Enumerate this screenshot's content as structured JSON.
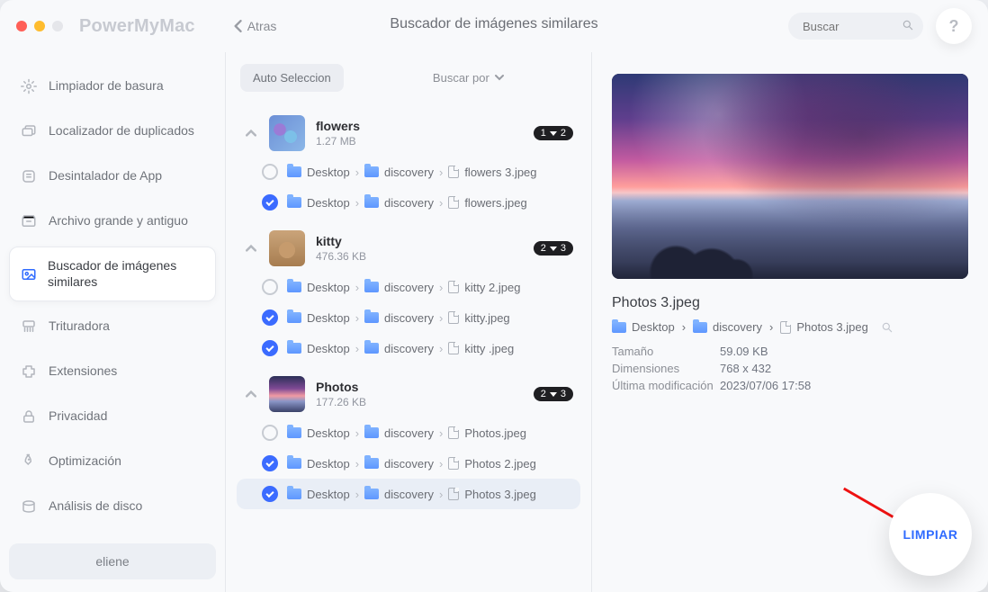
{
  "app": {
    "name": "PowerMyMac",
    "back": "Atras",
    "title": "Buscador de imágenes similares"
  },
  "search": {
    "placeholder": "Buscar"
  },
  "help": {
    "symbol": "?"
  },
  "sidebar": {
    "items": [
      {
        "label": "Limpiador de basura"
      },
      {
        "label": "Localizador de duplicados"
      },
      {
        "label": "Desintalador de App"
      },
      {
        "label": "Archivo grande y antiguo"
      },
      {
        "label": "Buscador de imágenes similares"
      },
      {
        "label": "Trituradora"
      },
      {
        "label": "Extensiones"
      },
      {
        "label": "Privacidad"
      },
      {
        "label": "Optimización"
      },
      {
        "label": "Análisis de disco"
      }
    ],
    "user": "eliene"
  },
  "toolbar": {
    "auto": "Auto Seleccion",
    "sort": "Buscar por"
  },
  "path": {
    "p1": "Desktop",
    "p2": "discovery"
  },
  "groups": [
    {
      "name": "flowers",
      "size": "1.27 MB",
      "badge": "1 · 2",
      "rows": [
        {
          "checked": false,
          "file": "flowers 3.jpeg"
        },
        {
          "checked": true,
          "file": "flowers.jpeg"
        }
      ]
    },
    {
      "name": "kitty",
      "size": "476.36 KB",
      "badge": "2 · 3",
      "rows": [
        {
          "checked": false,
          "file": "kitty 2.jpeg"
        },
        {
          "checked": true,
          "file": "kitty.jpeg"
        },
        {
          "checked": true,
          "file": "kitty .jpeg"
        }
      ]
    },
    {
      "name": "Photos",
      "size": "177.26 KB",
      "badge": "2 · 3",
      "rows": [
        {
          "checked": false,
          "file": "Photos.jpeg"
        },
        {
          "checked": true,
          "file": "Photos 2.jpeg"
        },
        {
          "checked": true,
          "file": "Photos 3.jpeg",
          "selected": true
        }
      ]
    }
  ],
  "preview": {
    "file": "Photos 3.jpeg",
    "path_file": "Photos 3.jpeg",
    "meta": {
      "size_label": "Tamaño",
      "size": "59.09 KB",
      "dims_label": "Dimensiones",
      "dims": "768 x 432",
      "mod_label": "Última modificación",
      "mod": "2023/07/06 17:58"
    },
    "clean": "LIMPIAR"
  }
}
